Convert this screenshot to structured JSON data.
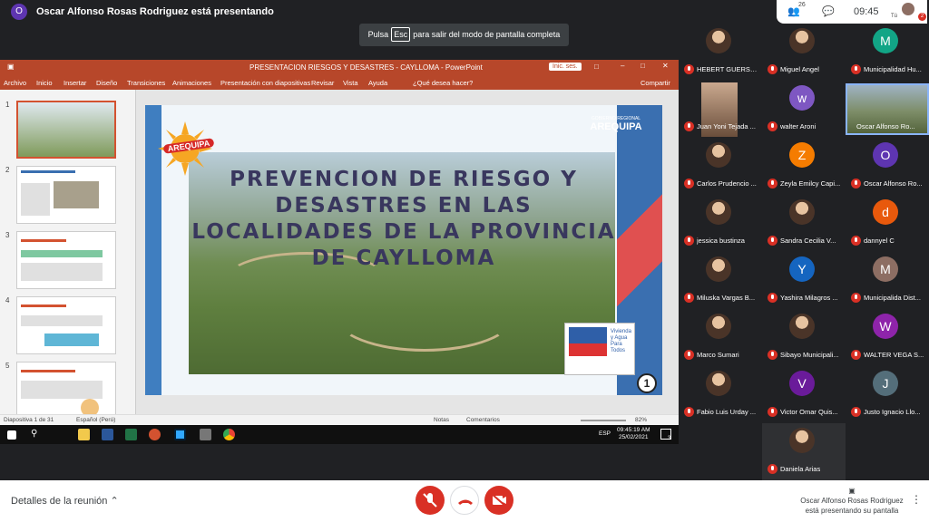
{
  "presenter_banner": {
    "avatar_letter": "O",
    "text": "Oscar Alfonso Rosas Rodriguez está presentando"
  },
  "top_right": {
    "people_count": "26",
    "time": "09:45",
    "you_label": "Tú",
    "chat_badge": "2"
  },
  "esc_hint": {
    "before": "Pulsa",
    "key": "Esc",
    "after": "para salir del modo de pantalla completa"
  },
  "powerpoint": {
    "title": "PRESENTACION RIESGOS Y DESASTRES - CAYLLOMA  -  PowerPoint",
    "signin": "Inic. ses.",
    "ribbon_tabs": [
      "Archivo",
      "Inicio",
      "Insertar",
      "Diseño",
      "Transiciones",
      "Animaciones",
      "Presentación con diapositivas",
      "Revisar",
      "Vista",
      "Ayuda",
      "¿Qué desea hacer?"
    ],
    "share": "Compartir",
    "slide_numbers": [
      "1",
      "2",
      "3",
      "4",
      "5"
    ],
    "slide": {
      "title": "PREVENCION DE RIESGO Y DESASTRES EN LAS LOCALIDADES DE LA PROVINCIA DE CAYLLOMA",
      "city_logo": "AREQUIPA",
      "region_small": "GOBIERNO REGIONAL",
      "region_big": "AREQUIPA",
      "badge_text": "Vivienda y Agua Para Todos",
      "page_number": "1"
    },
    "status": {
      "slide_counter": "Diapositiva 1 de 31",
      "language": "Español (Perú)",
      "notes": "Notas",
      "comments": "Comentarios",
      "zoom": "82%"
    },
    "taskbar": {
      "time": "09:45:19 AM",
      "date": "25/02/2021",
      "lang": "ESP",
      "notification_badge": "3"
    }
  },
  "participants": [
    {
      "name": "HEBERT GUERSO...",
      "type": "photo",
      "color": ""
    },
    {
      "name": "Miguel Angel",
      "type": "photo",
      "color": ""
    },
    {
      "name": "Municipalidad Hu...",
      "type": "letter",
      "letter": "M",
      "color": "#12a586"
    },
    {
      "name": "Juan Yoni Tejada ...",
      "type": "video",
      "color": ""
    },
    {
      "name": "walter Aroni",
      "type": "letter",
      "letter": "w",
      "color": "#7e57c2"
    },
    {
      "name": "Oscar Alfonso Ro...",
      "type": "video-wide",
      "color": ""
    },
    {
      "name": "Carlos Prudencio ...",
      "type": "photo",
      "color": ""
    },
    {
      "name": "Zeyla Emilcy Capi...",
      "type": "letter",
      "letter": "Z",
      "color": "#f57c00"
    },
    {
      "name": "Oscar Alfonso Ro...",
      "type": "letter",
      "letter": "O",
      "color": "#5e35b1"
    },
    {
      "name": "jessica bustinza",
      "type": "photo",
      "color": ""
    },
    {
      "name": "Sandra Cecilia V...",
      "type": "photo",
      "color": ""
    },
    {
      "name": "dannyel C",
      "type": "letter",
      "letter": "d",
      "color": "#e8590c"
    },
    {
      "name": "Miluska Vargas B...",
      "type": "photo",
      "color": ""
    },
    {
      "name": "Yashira Milagros ...",
      "type": "letter",
      "letter": "Y",
      "color": "#1565c0"
    },
    {
      "name": "Municipalida Dist...",
      "type": "letter",
      "letter": "M",
      "color": "#8d6e63"
    },
    {
      "name": "Marco Sumari",
      "type": "photo",
      "color": ""
    },
    {
      "name": "Sibayo Municipali...",
      "type": "photo",
      "color": ""
    },
    {
      "name": "WALTER VEGA S...",
      "type": "letter",
      "letter": "W",
      "color": "#8e24aa"
    },
    {
      "name": "Fabio Luis Urday ...",
      "type": "photo",
      "color": ""
    },
    {
      "name": "Victor Omar Quis...",
      "type": "letter",
      "letter": "V",
      "color": "#6a1b9a"
    },
    {
      "name": "Justo Ignacio Llo...",
      "type": "letter",
      "letter": "J",
      "color": "#546e7a"
    },
    {
      "name": "Daniela Arias",
      "type": "photo",
      "color": ""
    }
  ],
  "bottom": {
    "details": "Detalles de la reunión",
    "present_note_1": "Oscar Alfonso Rosas Rodriguez",
    "present_note_2": "está presentando su pantalla"
  },
  "colors": {
    "ppt_accent": "#b7472a",
    "meet_red": "#d93025"
  }
}
